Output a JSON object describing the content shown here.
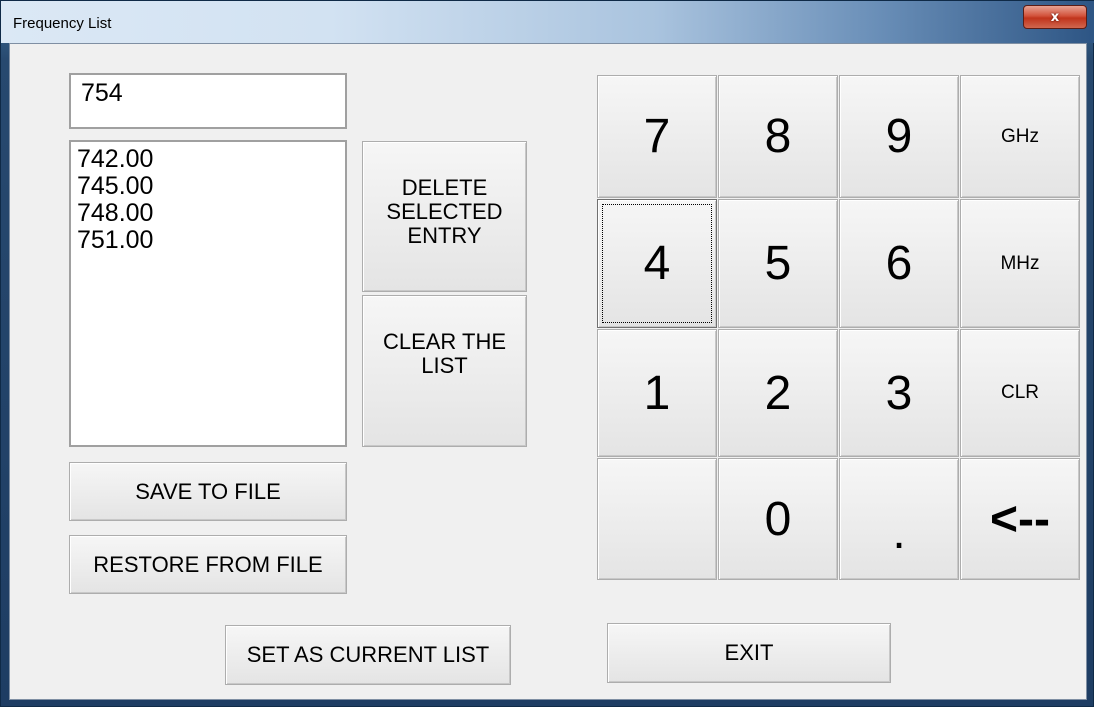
{
  "window": {
    "title": "Frequency List",
    "close_label": "x"
  },
  "input": {
    "value": "754"
  },
  "frequency_list": [
    "742.00",
    "745.00",
    "748.00",
    "751.00"
  ],
  "buttons": {
    "delete_entry": "DELETE\nSELECTED\nENTRY",
    "clear_list": "CLEAR THE\nLIST",
    "save_to_file": "SAVE TO FILE",
    "restore_from_file": "RESTORE FROM FILE",
    "set_current": "SET AS CURRENT LIST",
    "exit": "EXIT"
  },
  "keypad": {
    "k7": "7",
    "k8": "8",
    "k9": "9",
    "ghz": "GHz",
    "k4": "4",
    "k5": "5",
    "k6": "6",
    "mhz": "MHz",
    "k1": "1",
    "k2": "2",
    "k3": "3",
    "clr": "CLR",
    "blank": "",
    "k0": "0",
    "dot": ".",
    "back": "<--"
  }
}
